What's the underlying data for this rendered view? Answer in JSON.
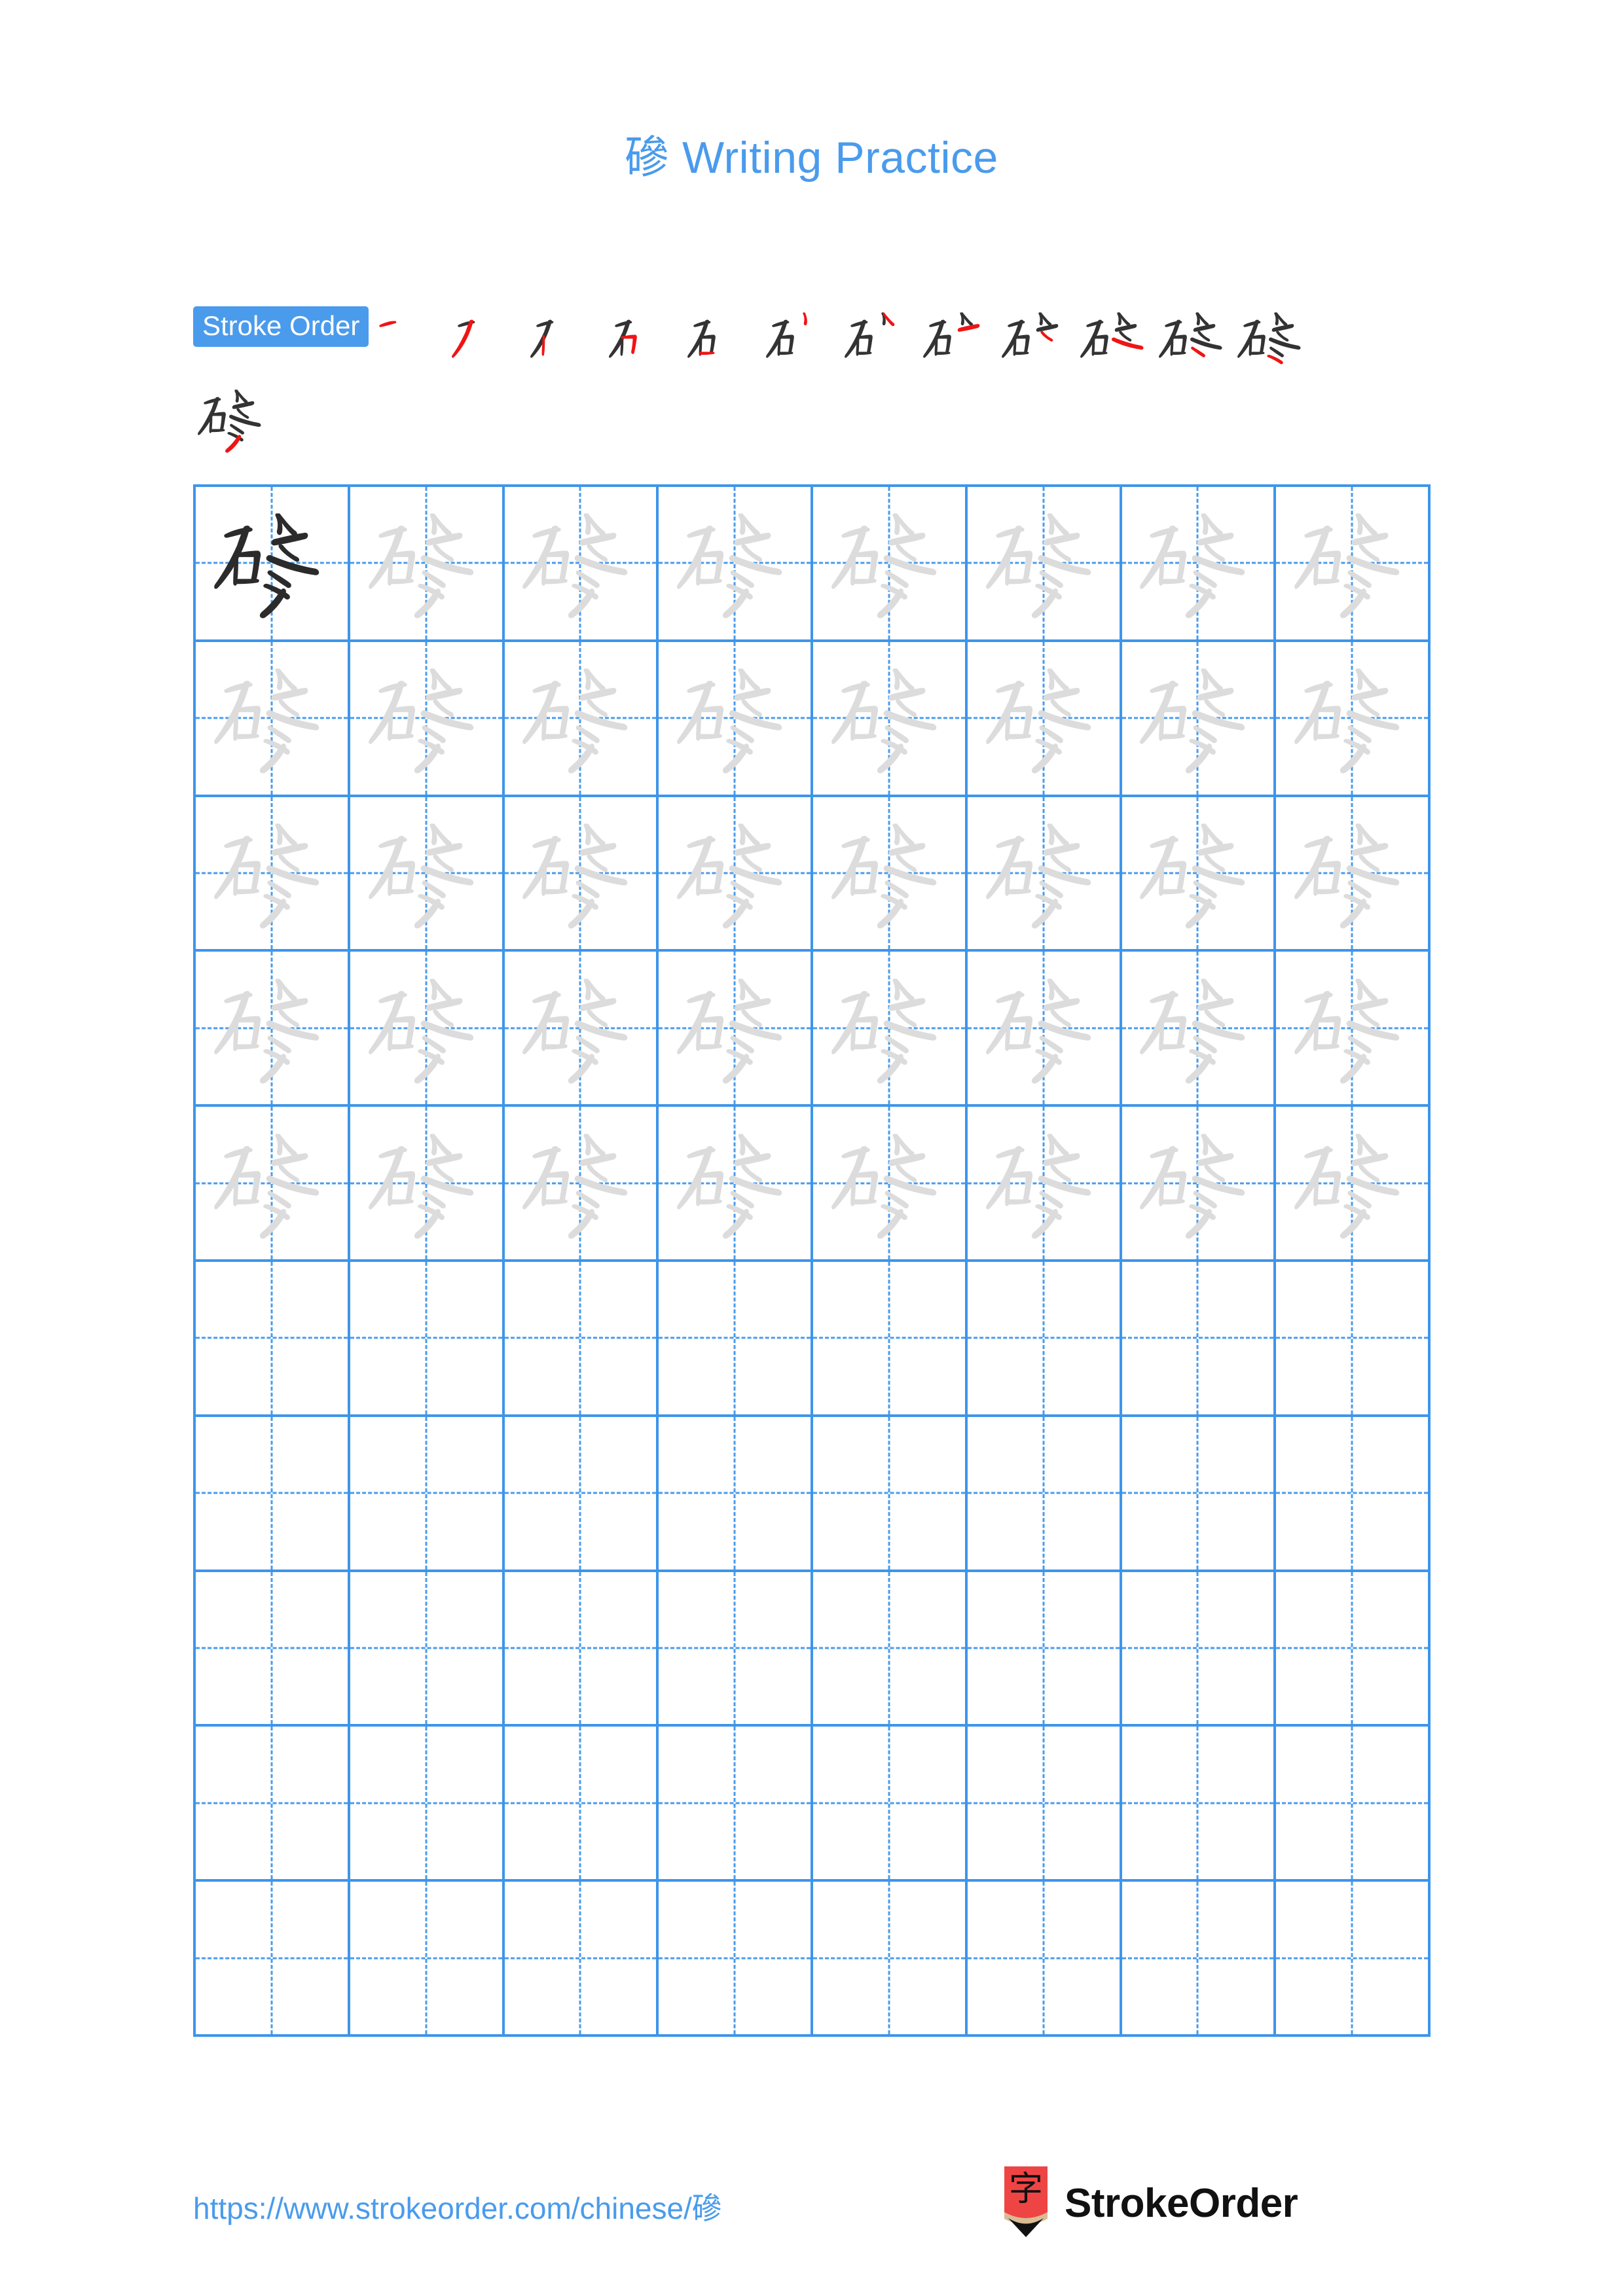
{
  "character": "磣",
  "title": "磣 Writing Practice",
  "colors": {
    "accent_blue": "#4a9bec",
    "grid_blue": "#3d95ea",
    "stroke_black": "#333333",
    "stroke_highlight_red": "#f01414",
    "trace_gray": "#dcdcdc",
    "logo_red": "#ef4444",
    "logo_wood": "#d9bc94",
    "page_background": "#ffffff"
  },
  "stroke_order": {
    "badge_label": "Stroke Order",
    "total_strokes": 13,
    "rows": [
      {
        "steps": [
          1,
          2,
          3,
          4,
          5,
          6,
          7,
          8,
          9,
          10,
          11,
          12
        ]
      },
      {
        "steps": [
          13
        ]
      }
    ]
  },
  "practice_grid": {
    "columns": 8,
    "rows": 10,
    "filled_rows": 5,
    "empty_rows": 5,
    "cells": [
      [
        "solid",
        "trace",
        "trace",
        "trace",
        "trace",
        "trace",
        "trace",
        "trace"
      ],
      [
        "trace",
        "trace",
        "trace",
        "trace",
        "trace",
        "trace",
        "trace",
        "trace"
      ],
      [
        "trace",
        "trace",
        "trace",
        "trace",
        "trace",
        "trace",
        "trace",
        "trace"
      ],
      [
        "trace",
        "trace",
        "trace",
        "trace",
        "trace",
        "trace",
        "trace",
        "trace"
      ],
      [
        "trace",
        "trace",
        "trace",
        "trace",
        "trace",
        "trace",
        "trace",
        "trace"
      ],
      [
        "empty",
        "empty",
        "empty",
        "empty",
        "empty",
        "empty",
        "empty",
        "empty"
      ],
      [
        "empty",
        "empty",
        "empty",
        "empty",
        "empty",
        "empty",
        "empty",
        "empty"
      ],
      [
        "empty",
        "empty",
        "empty",
        "empty",
        "empty",
        "empty",
        "empty",
        "empty"
      ],
      [
        "empty",
        "empty",
        "empty",
        "empty",
        "empty",
        "empty",
        "empty",
        "empty"
      ],
      [
        "empty",
        "empty",
        "empty",
        "empty",
        "empty",
        "empty",
        "empty",
        "empty"
      ]
    ]
  },
  "footer": {
    "url": "https://www.strokeorder.com/chinese/磣",
    "brand_name": "StrokeOrder",
    "logo_character": "字",
    "logo_icon": "pencil-icon"
  }
}
